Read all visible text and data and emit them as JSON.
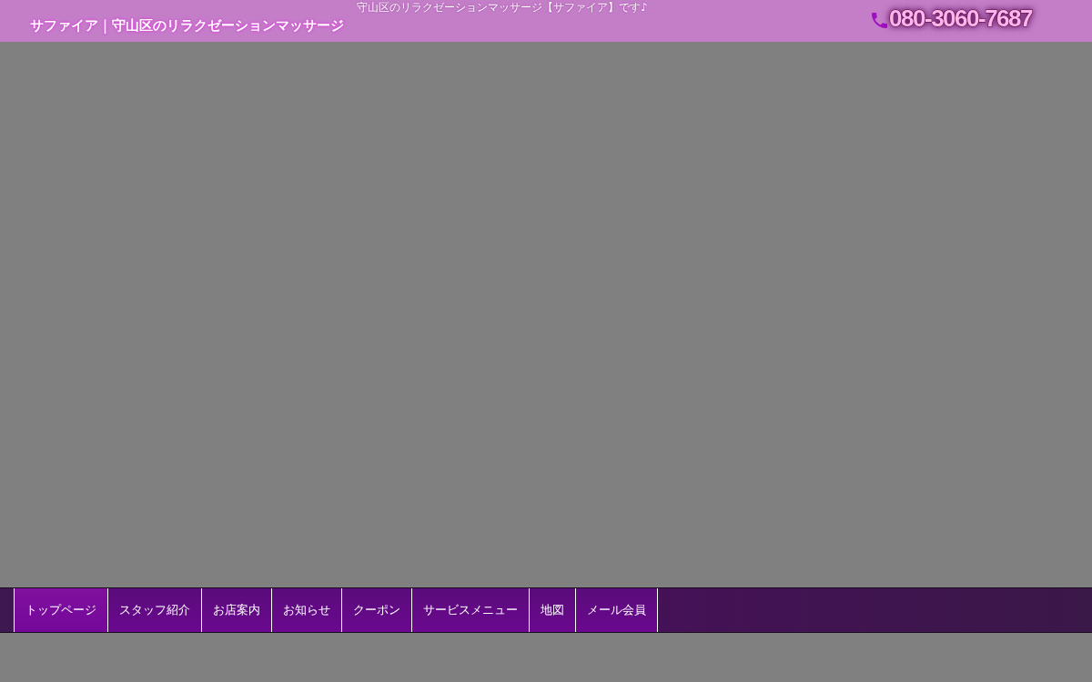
{
  "header": {
    "tagline": "守山区のリラクゼーションマッサージ【サファイア】です♪",
    "site_title": "サファイア｜守山区のリラクゼーションマッサージ",
    "phone": "080-3060-7687"
  },
  "nav": {
    "items": [
      {
        "label": "トップページ",
        "selected": true
      },
      {
        "label": "スタッフ紹介",
        "selected": false
      },
      {
        "label": "お店案内",
        "selected": false
      },
      {
        "label": "お知らせ",
        "selected": false
      },
      {
        "label": "クーポン",
        "selected": false
      },
      {
        "label": "サービスメニュー",
        "selected": false
      },
      {
        "label": "地図",
        "selected": false
      },
      {
        "label": "メール会員",
        "selected": false
      }
    ]
  }
}
